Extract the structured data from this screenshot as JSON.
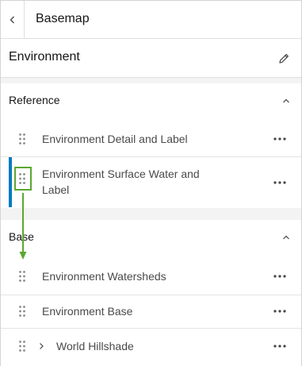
{
  "header": {
    "title": "Basemap"
  },
  "environment": {
    "title": "Environment"
  },
  "reference": {
    "title": "Reference",
    "layers": [
      {
        "label": "Environment Detail and Label"
      },
      {
        "label_line1": "Environment Surface Water and",
        "label_line2": "Label"
      }
    ]
  },
  "base": {
    "title": "Base",
    "layers": [
      {
        "label": "Environment Watersheds"
      },
      {
        "label": "Environment Base"
      },
      {
        "label": "World Hillshade"
      }
    ]
  },
  "colors": {
    "accent": "#007ac2",
    "drag_highlight": "#5ba730"
  },
  "icons": {
    "back": "chevron-left-icon",
    "edit": "pencil-icon",
    "collapse": "chevron-up-icon",
    "handle": "drag-handle-icon",
    "more": "ellipsis-icon",
    "expand": "chevron-right-icon"
  }
}
